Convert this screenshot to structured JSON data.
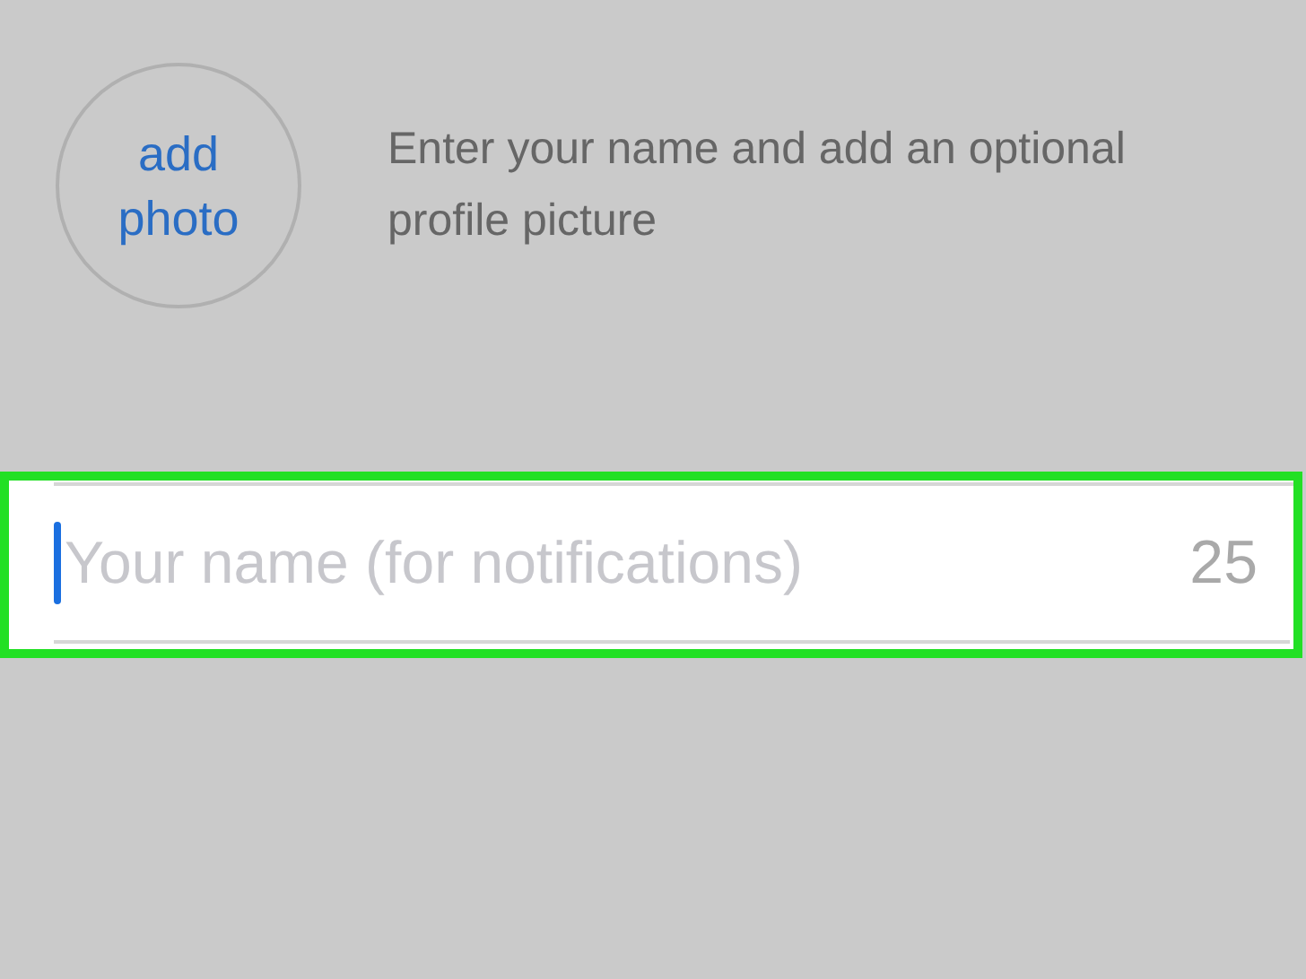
{
  "profile": {
    "photo_button": "add photo",
    "instructions": "Enter your name and add an optional profile picture"
  },
  "name_field": {
    "placeholder": "Your name (for notifications)",
    "focused": true,
    "counter": "25",
    "highlighted": true
  }
}
